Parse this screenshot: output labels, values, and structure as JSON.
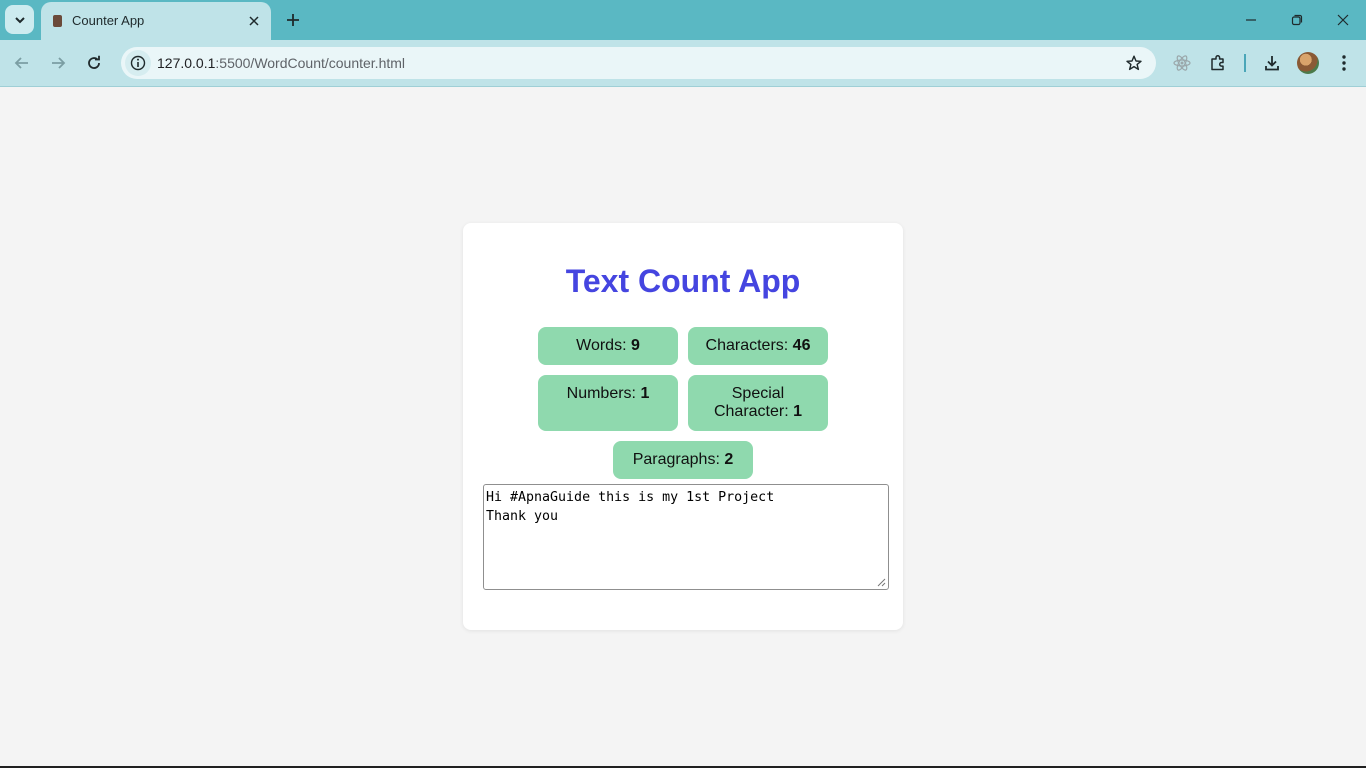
{
  "browser": {
    "tab": {
      "title": "Counter App",
      "favicon": "book-icon"
    },
    "url": {
      "host": "127.0.0.1",
      "rest": ":5500/WordCount/counter.html"
    },
    "icons": [
      "tab-search-icon",
      "close-icon",
      "plus-icon",
      "minimize-icon",
      "restore-icon",
      "window-close-icon",
      "back-arrow-icon",
      "forward-arrow-icon",
      "reload-icon",
      "site-info-icon",
      "bookmark-star-icon",
      "react-devtools-icon",
      "extensions-icon",
      "download-icon",
      "profile-avatar",
      "more-menu-icon"
    ]
  },
  "app": {
    "title": "Text Count App",
    "stats": {
      "words": {
        "label": "Words: ",
        "value": "9"
      },
      "characters": {
        "label": "Characters: ",
        "value": "46"
      },
      "numbers": {
        "label": "Numbers: ",
        "value": "1"
      },
      "special": {
        "label_line1": "Special",
        "label_line2": "Character: ",
        "value": "1"
      },
      "paragraphs": {
        "label": "Paragraphs: ",
        "value": "2"
      }
    },
    "textarea": {
      "value": "Hi #ApnaGuide this is my 1st Project\nThank you"
    }
  },
  "colors": {
    "tabstrip": "#5ab8c3",
    "toolbar": "#bfe3e8",
    "title": "#4545e0",
    "stat_bg": "#8fd9ae",
    "page_bg": "#f4f4f4"
  }
}
